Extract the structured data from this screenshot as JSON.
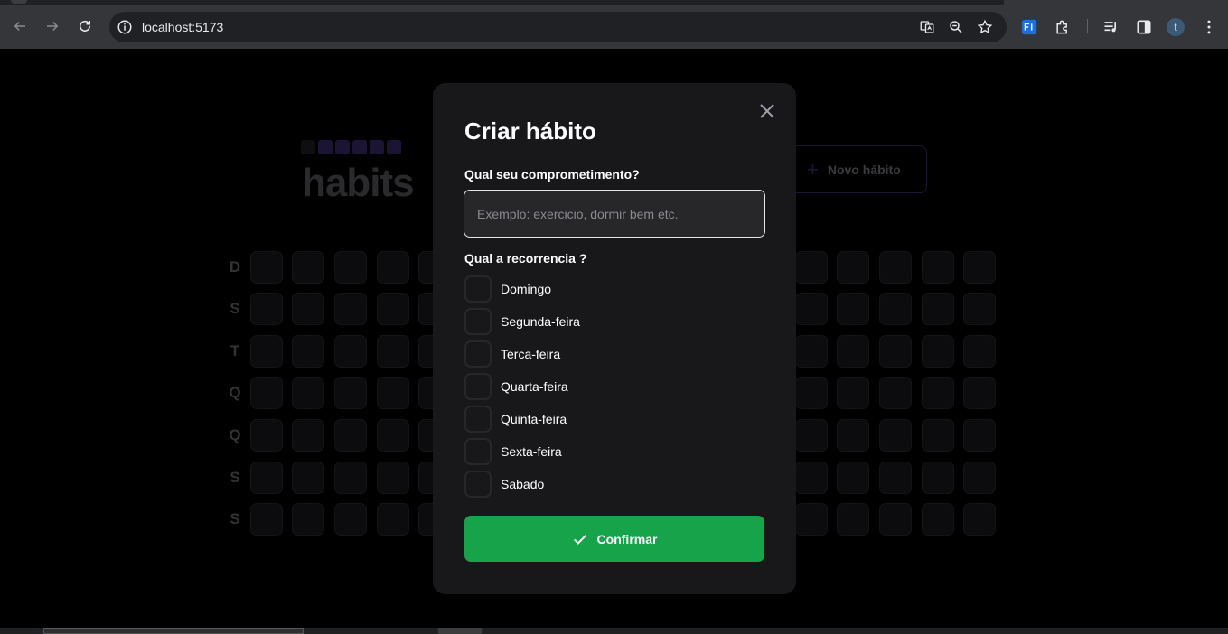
{
  "browser": {
    "url": "localhost:5173",
    "avatar_letter": "t"
  },
  "app": {
    "logo_text": "habits",
    "new_habit_label": "Novo hábito",
    "weekdays": [
      "D",
      "S",
      "T",
      "Q",
      "Q",
      "S",
      "S"
    ]
  },
  "modal": {
    "title": "Criar hábito",
    "commitment_label": "Qual seu comprometimento?",
    "commitment_placeholder": "Exemplo: exercicio, dormir bem etc.",
    "commitment_value": "",
    "recurrence_label": "Qual a recorrencia ?",
    "days": [
      {
        "label": "Domingo",
        "checked": false
      },
      {
        "label": "Segunda-feira",
        "checked": false
      },
      {
        "label": "Terca-feira",
        "checked": false
      },
      {
        "label": "Quarta-feira",
        "checked": false
      },
      {
        "label": "Quinta-feira",
        "checked": false
      },
      {
        "label": "Sexta-feira",
        "checked": false
      },
      {
        "label": "Sabado",
        "checked": false
      }
    ],
    "confirm_label": "Confirmar"
  },
  "colors": {
    "confirm_bg": "#16a34a",
    "modal_bg": "#18181b",
    "input_bg": "#27272a"
  }
}
